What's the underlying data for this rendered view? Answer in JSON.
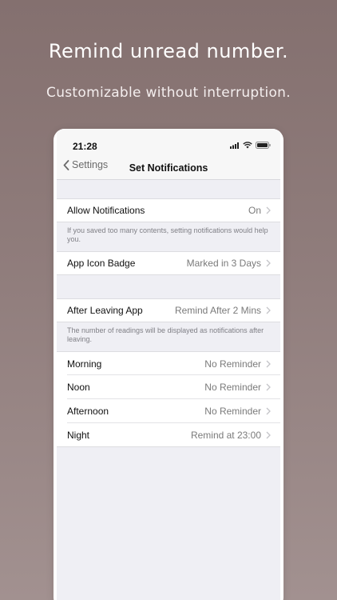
{
  "promo": {
    "headline": "Remind unread number.",
    "subline": "Customizable without interruption."
  },
  "statusbar": {
    "time": "21:28",
    "icons": [
      "cellular-signal-icon",
      "wifi-icon",
      "battery-icon"
    ]
  },
  "navbar": {
    "back_label": "Settings",
    "title": "Set Notifications"
  },
  "groups": {
    "allow": {
      "label": "Allow Notifications",
      "value": "On"
    },
    "allow_footer": "If you saved too many contents, setting notifications would help you.",
    "badge": {
      "label": "App Icon Badge",
      "value": "Marked in 3 Days"
    },
    "leaving": {
      "label": "After Leaving App",
      "value": "Remind After 2 Mins"
    },
    "leaving_footer": "The number of readings will be displayed as notifications after leaving.",
    "times": [
      {
        "label": "Morning",
        "value": "No Reminder"
      },
      {
        "label": "Noon",
        "value": "No Reminder"
      },
      {
        "label": "Afternoon",
        "value": "No Reminder"
      },
      {
        "label": "Night",
        "value": "Remind at 23:00"
      }
    ]
  },
  "colors": {
    "background_top": "#84706f",
    "background_bottom": "#a29190",
    "grouped_background": "#efeff4"
  }
}
